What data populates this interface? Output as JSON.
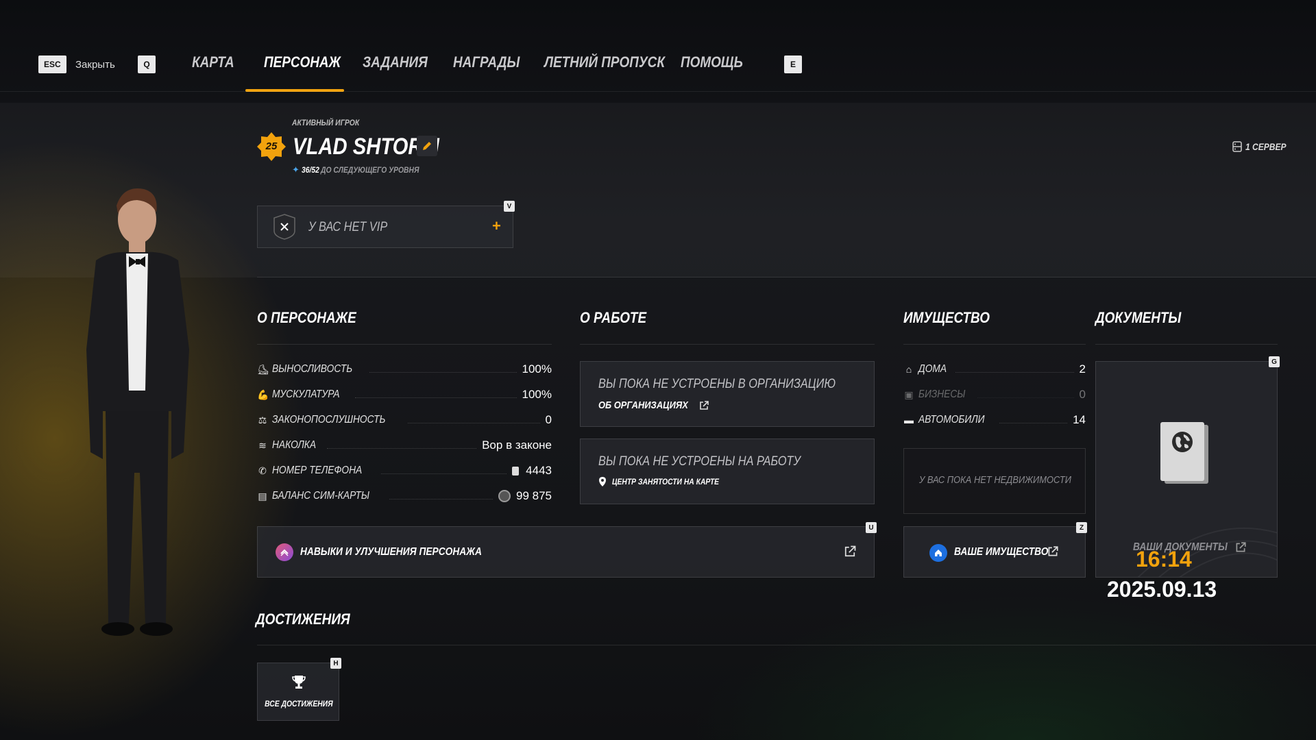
{
  "nav": {
    "esc_key": "ESC",
    "close_label": "Закрыть",
    "left_key": "Q",
    "right_key": "E",
    "tabs": [
      {
        "label": "КАРТА"
      },
      {
        "label": "ПЕРСОНАЖ",
        "active": true
      },
      {
        "label": "ЗАДАНИЯ"
      },
      {
        "label": "НАГРАДЫ"
      },
      {
        "label": "ЛЕТНИЙ ПРОПУСК"
      },
      {
        "label": "ПОМОЩЬ"
      }
    ]
  },
  "profile": {
    "status": "АКТИВНЫЙ ИГРОК",
    "level": "25",
    "name": "VLAD SHTORM",
    "xp": "36/52",
    "xp_suffix": "ДО СЛЕДУЮЩЕГО УРОВНЯ",
    "server": "1 СЕРВЕР"
  },
  "vip": {
    "key": "V",
    "label": "У ВАС НЕТ VIP",
    "add_symbol": "+"
  },
  "character": {
    "title": "О ПЕРСОНАЖЕ",
    "stats": [
      {
        "icon": "shoe-icon",
        "label": "ВЫНОСЛИВОСТЬ",
        "value": "100%"
      },
      {
        "icon": "muscle-icon",
        "label": "МУСКУЛАТУРА",
        "value": "100%"
      },
      {
        "icon": "law-icon",
        "label": "ЗАКОНОПОСЛУШНОСТЬ",
        "value": "0"
      },
      {
        "icon": "tattoo-icon",
        "label": "НАКОЛКА",
        "value": "Вор в законе"
      },
      {
        "icon": "phone-icon",
        "label": "НОМЕР ТЕЛЕФОНА",
        "value": "4443"
      },
      {
        "icon": "sim-icon",
        "label": "БАЛАНС СИМ-КАРТЫ",
        "value": "99 875"
      }
    ],
    "skills_label": "НАВЫКИ И УЛУЧШЕНИЯ ПЕРСОНАЖА",
    "skills_key": "U"
  },
  "work": {
    "title": "О РАБОТЕ",
    "org_text": "ВЫ ПОКА НЕ УСТРОЕНЫ В ОРГАНИЗАЦИЮ",
    "org_link": "ОБ ОРГАНИЗАЦИЯХ",
    "job_text": "ВЫ ПОКА НЕ УСТРОЕНЫ НА РАБОТУ",
    "job_link": "ЦЕНТР ЗАНЯТОСТИ НА КАРТЕ"
  },
  "property": {
    "title": "ИМУЩЕСТВО",
    "items": [
      {
        "icon": "house-icon",
        "label": "ДОМА",
        "value": "2",
        "dim": false
      },
      {
        "icon": "business-icon",
        "label": "БИЗНЕСЫ",
        "value": "0",
        "dim": true
      },
      {
        "icon": "car-icon",
        "label": "АВТОМОБИЛИ",
        "value": "14",
        "dim": false
      }
    ],
    "empty_text": "У ВАС ПОКА НЕТ НЕДВИЖИМОСТИ",
    "link_label": "ВАШЕ ИМУЩЕСТВО",
    "link_key": "Z"
  },
  "documents": {
    "title": "ДОКУМЕНТЫ",
    "key": "G",
    "link_label": "ВАШИ ДОКУМЕНТЫ"
  },
  "achievements": {
    "title": "ДОСТИЖЕНИЯ",
    "key": "H",
    "button_label": "ВСЕ ДОСТИЖЕНИЯ"
  },
  "clock": {
    "time": "16:14",
    "date": "2025.09.13"
  },
  "colors": {
    "accent": "#f2a20d",
    "blue": "#1d6fe0"
  }
}
